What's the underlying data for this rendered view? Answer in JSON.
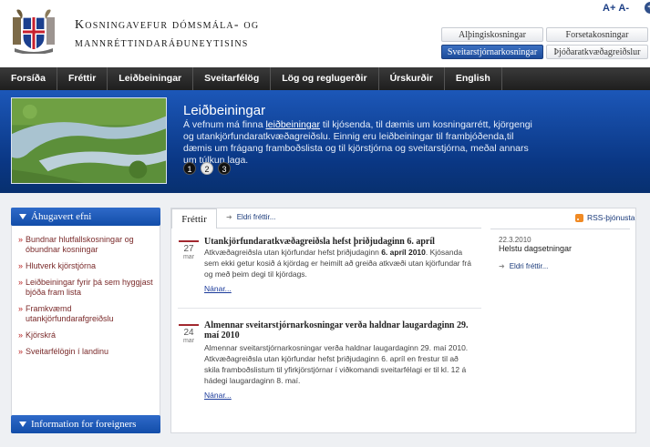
{
  "header": {
    "title_line1": "Kosningavefur dómsmála- og",
    "title_line2": "mannréttindaráðuneytisins",
    "font_increase": "A+",
    "font_decrease": "A-",
    "plus_symbol": "+",
    "election_buttons": [
      "Alþingiskosningar",
      "Forsetakosningar",
      "Sveitarstjórnarkosningar",
      "Þjóðaratkvæðagreiðslur"
    ]
  },
  "nav": [
    "Forsíða",
    "Fréttir",
    "Leiðbeiningar",
    "Sveitarfélög",
    "Lög og reglugerðir",
    "Úrskurðir",
    "English"
  ],
  "banner": {
    "title": "Leiðbeiningar",
    "text_before": "Á vefnum má finna ",
    "link": "leiðbeiningar",
    "text_after": " til kjósenda, til dæmis um kosningarrétt, kjörgengi og utankjörfundaratkvæðagreiðslu. Einnig eru leiðbeiningar til frambjóðenda,til dæmis um frágang framboðslista og til kjörstjórna og sveitarstjórna, meðal annars um túlkun laga.",
    "dots": [
      "1",
      "2",
      "3"
    ],
    "active_dot": 1
  },
  "sidebar": {
    "heading": "Áhugavert efni",
    "items": [
      "Bundnar hlutfallskosningar og óbundnar kosningar",
      "Hlutverk kjörstjórna",
      "Leiðbeiningar fyrir þá sem hyggjast bjóða fram lista",
      "Framkvæmd utankjörfundarafgreiðslu",
      "Kjörskrá",
      "Sveitarfélögin í landinu"
    ],
    "foreign_heading": "Information for foreigners"
  },
  "main": {
    "tab_label": "Fréttir",
    "older_news": "Eldri fréttir...",
    "news": [
      {
        "day": "27",
        "month": "mar",
        "title": "Utankjörfundaratkvæðagreiðsla hefst þriðjudaginn 6. apríl",
        "body_a": "Atkvæðagreiðsla utan kjörfundar hefst þriðjudaginn ",
        "body_bold": "6. apríl 2010",
        "body_b": ". Kjósanda sem ekki getur kosið á kjördag er heimilt að greiða atkvæði utan kjörfundar frá og með þeim degi til kjördags.",
        "more": "Nánar..."
      },
      {
        "day": "24",
        "month": "mar",
        "title": "Almennar sveitarstjórnarkosningar verða haldnar laugardaginn 29. maí 2010",
        "body": "Almennar sveitarstjórnarkosningar verða haldnar laugardaginn 29. maí 2010. Atkvæðagreiðsla utan kjörfundar hefst þriðjudaginn 6. apríl en frestur til að skila framboðslistum til yfirkjörstjórnar í viðkomandi sveitarfélagi er til kl. 12 á hádegi laugardaginn 8. maí.",
        "more": "Nánar..."
      }
    ],
    "rss_label": "RSS-þjónusta",
    "right": {
      "date": "22.3.2010",
      "title": "Helstu dagsetningar",
      "older": "Eldri fréttir..."
    }
  }
}
